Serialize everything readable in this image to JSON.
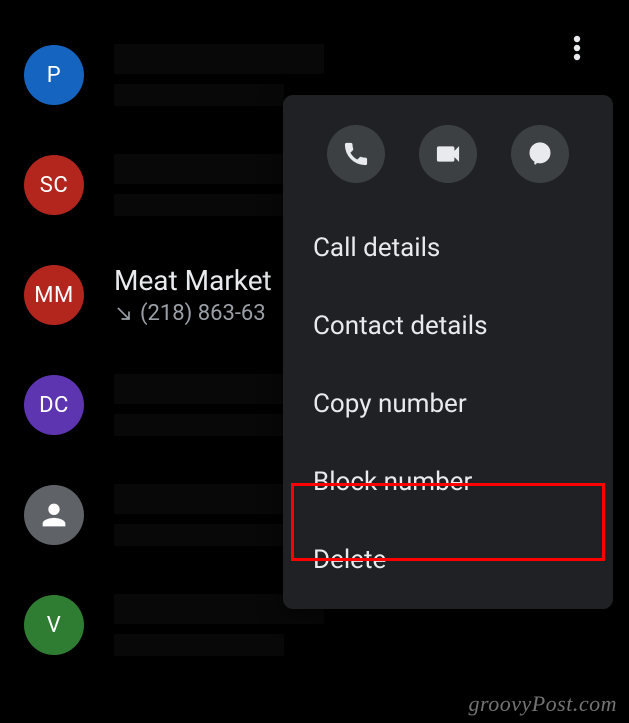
{
  "calls": [
    {
      "avatar_text": "P",
      "avatar_class": "blue",
      "name": "",
      "number": "",
      "redacted": true,
      "icon": false
    },
    {
      "avatar_text": "SC",
      "avatar_class": "red",
      "name": "",
      "number": "",
      "redacted": true,
      "icon": false
    },
    {
      "avatar_text": "MM",
      "avatar_class": "red",
      "name": "Meat Market",
      "number": "(218) 863-63",
      "redacted": false,
      "icon": false
    },
    {
      "avatar_text": "DC",
      "avatar_class": "purple",
      "name": "",
      "number": "",
      "redacted": true,
      "icon": false
    },
    {
      "avatar_text": "",
      "avatar_class": "grey",
      "name": "",
      "number": "",
      "redacted": true,
      "icon": true
    },
    {
      "avatar_text": "V",
      "avatar_class": "green",
      "name": "",
      "number": "",
      "redacted": true,
      "icon": false
    }
  ],
  "popup": {
    "menu": {
      "call_details": "Call details",
      "contact_details": "Contact details",
      "copy_number": "Copy number",
      "block_number": "Block number",
      "delete": "Delete"
    }
  },
  "watermark": "groovyPost.com"
}
